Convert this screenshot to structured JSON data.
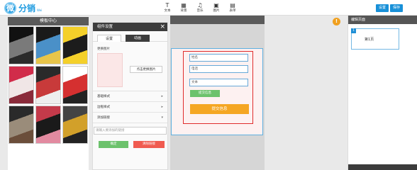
{
  "brand": {
    "logo_char": "微",
    "name": "分销",
    "sub": "Wei"
  },
  "toolbar": {
    "tools": [
      {
        "icon": "T",
        "label": "文本"
      },
      {
        "icon": "▦",
        "label": "背景"
      },
      {
        "icon": "♫",
        "label": "音乐"
      },
      {
        "icon": "▣",
        "label": "图片"
      },
      {
        "icon": "▤",
        "label": "表单"
      }
    ],
    "settings_label": "设置",
    "save_label": "保存"
  },
  "template_panel": {
    "title": "模板中心",
    "thumbnails": [
      {
        "colors": [
          "#111111",
          "#7a7a7a",
          "#2b2b2b"
        ]
      },
      {
        "colors": [
          "#1a1a1a",
          "#4a90c8",
          "#e8c54a"
        ]
      },
      {
        "colors": [
          "#f4d02a",
          "#1c1c1c",
          "#f4d02a"
        ]
      },
      {
        "colors": [
          "#d12c4a",
          "#f0e6e6",
          "#8a2b3a"
        ]
      },
      {
        "colors": [
          "#2a2a2a",
          "#c83a3a",
          "#eeeeee"
        ]
      },
      {
        "colors": [
          "#ffffff",
          "#d53030",
          "#222222"
        ]
      },
      {
        "colors": [
          "#2a2a2a",
          "#9a8c7a",
          "#6b4e3a"
        ]
      },
      {
        "colors": [
          "#c43a4a",
          "#1a1a1a",
          "#e28aa0"
        ]
      },
      {
        "colors": [
          "#444444",
          "#d2a02a",
          "#222222"
        ]
      }
    ]
  },
  "settings_panel": {
    "title": "组件设置",
    "close_icon": "×",
    "tabs": [
      {
        "label": "设置"
      },
      {
        "label": "动画"
      }
    ],
    "image_label": "更换图片",
    "change_image_button": "点击更换图片",
    "sections": [
      {
        "label": "基础样式",
        "arrow": "▸"
      },
      {
        "label": "边框样式",
        "arrow": "▸"
      },
      {
        "label": "添加链接",
        "arrow": "▾"
      }
    ],
    "link_placeholder": "请输入要添加的链接",
    "confirm_button": "确定",
    "clear_button": "清除链接"
  },
  "canvas": {
    "fields": [
      {
        "value": "姓名"
      },
      {
        "value": "电话"
      },
      {
        "value": "文本"
      }
    ],
    "submit_small": "提交信息",
    "submit_large": "提交信息"
  },
  "warning_icon": "!",
  "pages_panel": {
    "title": "编辑页面",
    "pages": [
      {
        "num": "1",
        "label": "第1页"
      }
    ]
  }
}
